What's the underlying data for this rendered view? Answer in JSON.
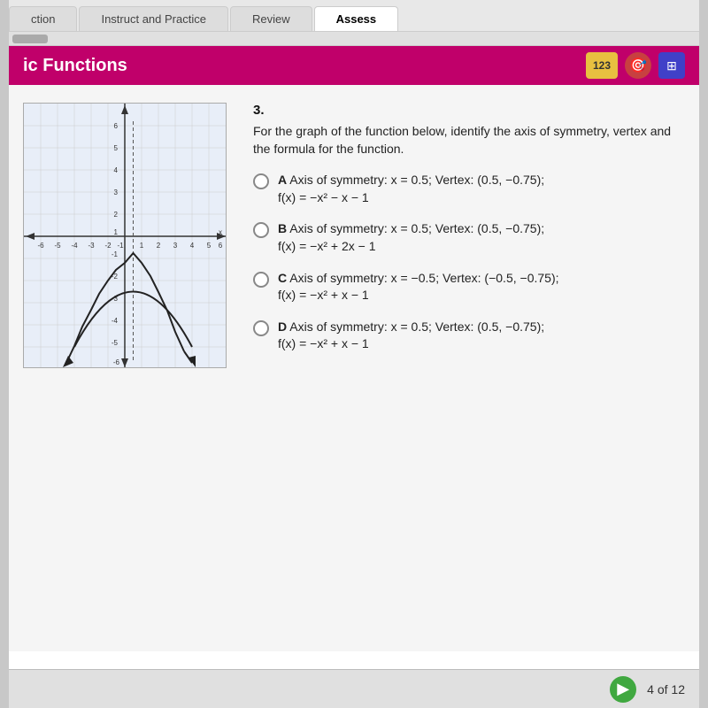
{
  "nav": {
    "tabs": [
      {
        "label": "ction",
        "active": false
      },
      {
        "label": "Instruct and Practice",
        "active": false
      },
      {
        "label": "Review",
        "active": false
      },
      {
        "label": "Assess",
        "active": true
      }
    ]
  },
  "header": {
    "title": "ic Functions",
    "icons": {
      "calc_label": "123",
      "target_icon": "🎯",
      "calculator_icon": "🔢"
    }
  },
  "question": {
    "number": "3.",
    "text": "For the graph of the function below, identify the axis of symmetry, vertex and the formula for the function.",
    "options": [
      {
        "letter": "A",
        "text1": "Axis of symmetry: x = 0.5; Vertex: (0.5, −0.75);",
        "text2": "f(x) = −x² − x − 1"
      },
      {
        "letter": "B",
        "text1": "Axis of symmetry: x = 0.5; Vertex: (0.5, −0.75);",
        "text2": "f(x) = −x² + 2x − 1"
      },
      {
        "letter": "C",
        "text1": "Axis of symmetry: x = −0.5; Vertex: (−0.5, −0.75);",
        "text2": "f(x) = −x² + x − 1"
      },
      {
        "letter": "D",
        "text1": "Axis of symmetry: x = 0.5; Vertex: (0.5, −0.75);",
        "text2": "f(x) = −x² + x − 1"
      }
    ]
  },
  "pagination": {
    "current": "4 of 12"
  },
  "graph": {
    "x_labels": [
      "-6",
      "-5",
      "-4",
      "-3",
      "-2",
      "-1",
      "1",
      "2",
      "3",
      "4",
      "5",
      "6"
    ],
    "y_labels": [
      "6",
      "5",
      "4",
      "3",
      "2",
      "1",
      "-1",
      "-2",
      "-3",
      "-4",
      "-5",
      "-6"
    ]
  }
}
